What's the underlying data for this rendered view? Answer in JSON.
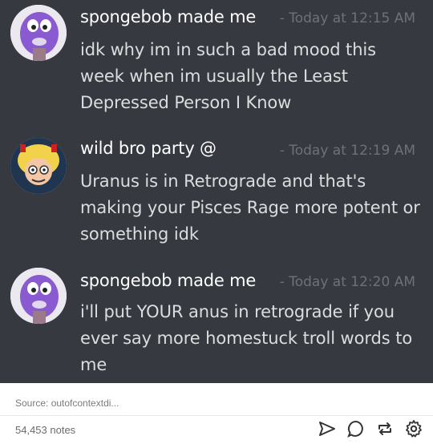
{
  "messages": [
    {
      "author": "spongebob made me",
      "time": "- Today at 12:15 AM",
      "text": "idk why im in such a bad mood this week when im usually the Least Depressed Person I Know",
      "avatar_icon": "purple-cartoon-face-icon"
    },
    {
      "author": "wild bro party @",
      "time": "- Today at 12:19 AM",
      "text": "Uranus is in Retrograde and that's making your Pisces Rage more potent or something idk",
      "avatar_icon": "cartoon-blonde-character-icon"
    },
    {
      "author": "spongebob made me",
      "time": "- Today at 12:20 AM",
      "text": "i'll put YOUR anus in retrograde if you ever say more homestuck troll words to me",
      "avatar_icon": "purple-cartoon-face-icon"
    }
  ],
  "footer": {
    "source": "Source: outofcontextdi...",
    "notes": "54,453 notes",
    "actions": [
      "share-icon",
      "reply-icon",
      "reblog-icon",
      "settings-icon"
    ]
  },
  "colors": {
    "chat_bg": "#36393f",
    "author": "#ffffff",
    "message_text": "#dcddde",
    "timestamp": "#6e7178"
  }
}
